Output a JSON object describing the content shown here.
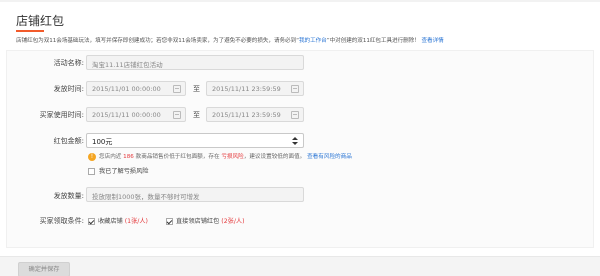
{
  "page": {
    "title": "店铺红包",
    "notice": {
      "text_before": "店铺红包为双11会场基础玩法，填写并保存即创建成功；若您非双11会场卖家，为了避免不必要的损失，请务必到“",
      "link_workbench": "我的工作台",
      "text_after": "”中对创建的双11红包工具进行删除！",
      "link_details": "查看详情"
    }
  },
  "form": {
    "activity_name": {
      "label": "活动名称:",
      "value": "淘宝11.11店铺红包活动"
    },
    "issue_time": {
      "label": "发放时间:",
      "start": "2015/11/01 00:00:00",
      "sep": "至",
      "end": "2015/11/11 23:59:59"
    },
    "use_time": {
      "label": "买家使用时间:",
      "start": "2015/11/11 00:00:00",
      "sep": "至",
      "end": "2015/11/11 23:59:59"
    },
    "amount": {
      "label": "红包金额:",
      "selected": "100元"
    },
    "warning": {
      "text_before": "您店内近",
      "count": "186",
      "text_mid": "款商品销售价低于红包面额，存在",
      "risk": "亏损风险",
      "text_after": "，建议设置较低的面值。",
      "link": "查看有风险的商品"
    },
    "acknowledge": {
      "label": "我已了解亏损风险",
      "checked": false
    },
    "quantity": {
      "label": "发放数量:",
      "placeholder": "投放限制1000张，数量不够时可增发"
    },
    "conditions": {
      "label": "买家领取条件:",
      "options": [
        {
          "label": "收藏店铺",
          "qty": "(1张/人)",
          "checked": true
        },
        {
          "label": "直接领店铺红包",
          "qty": "(2张/人)",
          "checked": true
        }
      ]
    }
  },
  "footer": {
    "save_label": "确定并保存"
  },
  "colors": {
    "accent": "#f25b2b",
    "link": "#2a75d5",
    "risk": "#e4393c",
    "warning": "#f5a623"
  }
}
